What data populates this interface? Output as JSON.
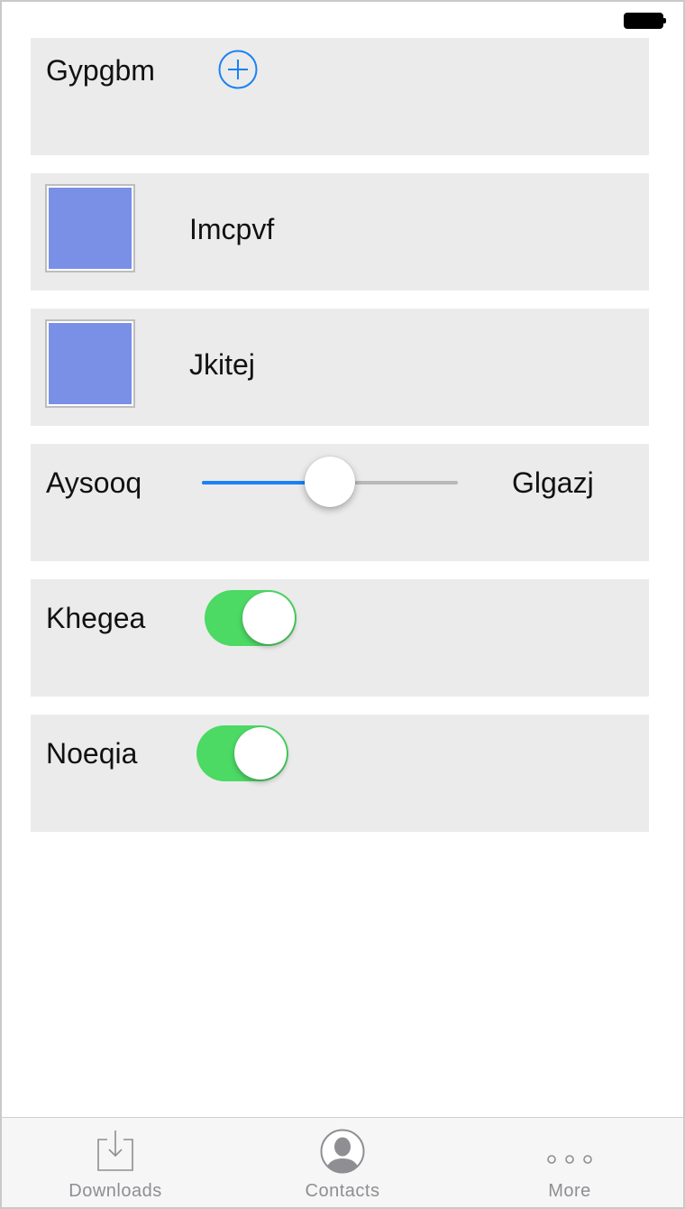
{
  "status_bar": {
    "battery_icon": "battery-icon"
  },
  "rows": [
    {
      "label": "Gypgbm",
      "icon": "plus-circle-icon",
      "accent": "#1a82f4"
    },
    {
      "label": "Imcpvf",
      "image_color": "#7990e6"
    },
    {
      "label": "Jkitej",
      "image_color": "#7990e6"
    },
    {
      "min_label": "Aysooq",
      "max_label": "Glgazj",
      "slider_value": 0.5,
      "track_color": "#1a82f4"
    },
    {
      "label": "Khegea",
      "on": true,
      "on_color": "#4cd964"
    },
    {
      "label": "Noeqia",
      "on": true,
      "on_color": "#4cd964"
    }
  ],
  "tab_bar": {
    "tabs": [
      {
        "label": "Downloads",
        "icon": "download-icon"
      },
      {
        "label": "Contacts",
        "icon": "contact-icon"
      },
      {
        "label": "More",
        "icon": "more-icon"
      }
    ]
  }
}
